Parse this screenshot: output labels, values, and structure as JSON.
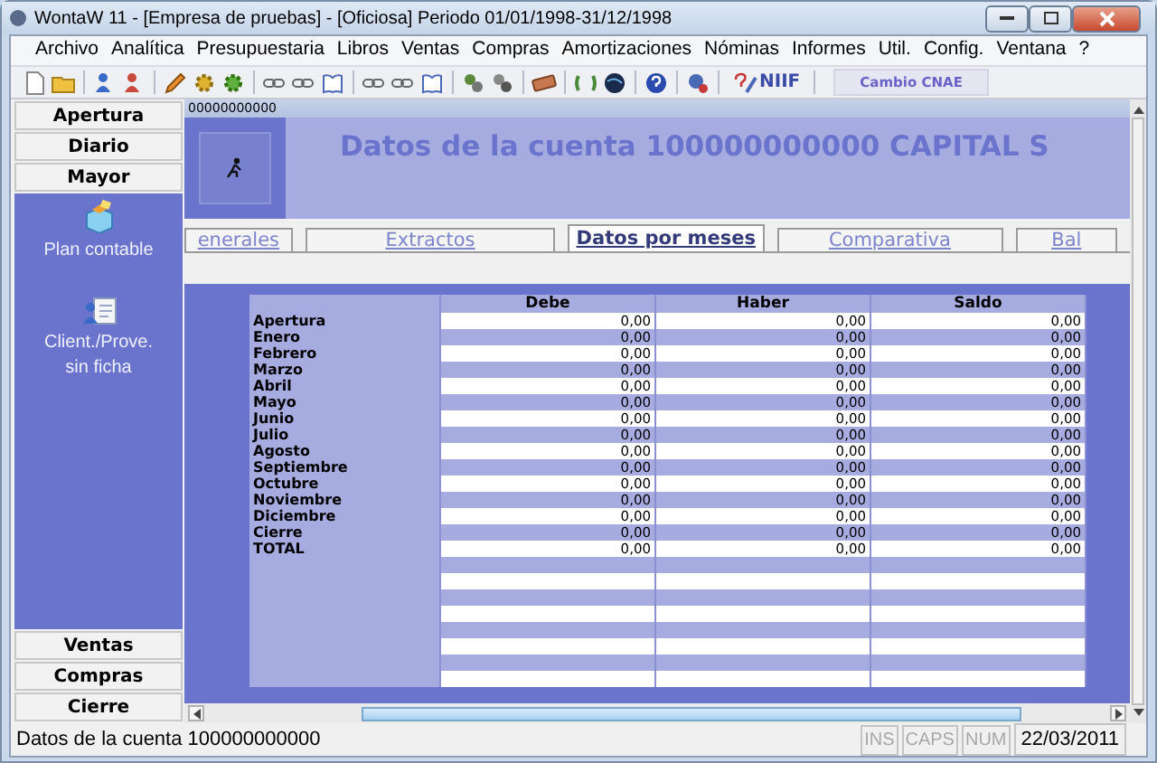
{
  "window": {
    "title": "WontaW 11 - [Empresa de pruebas] - [Oficiosa] Periodo 01/01/1998-31/12/1998"
  },
  "menu": [
    "Archivo",
    "Analítica",
    "Presupuestaria",
    "Libros",
    "Ventas",
    "Compras",
    "Amortizaciones",
    "Nóminas",
    "Informes",
    "Util.",
    "Config.",
    "Ventana",
    "?"
  ],
  "toolbar": {
    "niif_label": "NIIF",
    "cnae_button": "Cambio CNAE"
  },
  "sidebar": {
    "sections": [
      {
        "label": "Apertura"
      },
      {
        "label": "Diario"
      },
      {
        "label": "Mayor",
        "items": [
          {
            "kind": "plan",
            "label": "Plan contable"
          },
          {
            "kind": "contacts",
            "label": "Client./Prove. sin ficha"
          }
        ]
      },
      {
        "label": "Ventas"
      },
      {
        "label": "Compras"
      },
      {
        "label": "Cierre"
      }
    ]
  },
  "child_window": {
    "title": "00000000000",
    "heading": "Datos de la cuenta 100000000000 CAPITAL S",
    "tabs": [
      {
        "label": "enerales",
        "selected": false
      },
      {
        "label": "Extractos",
        "selected": false
      },
      {
        "label": "Datos por meses",
        "selected": true
      },
      {
        "label": "Comparativa",
        "selected": false
      },
      {
        "label": "Bal",
        "selected": false
      }
    ],
    "table": {
      "columns": [
        "Debe",
        "Haber",
        "Saldo"
      ],
      "rows": [
        {
          "label": "Apertura",
          "values": [
            "0,00",
            "0,00",
            "0,00"
          ]
        },
        {
          "label": "Enero",
          "values": [
            "0,00",
            "0,00",
            "0,00"
          ]
        },
        {
          "label": "Febrero",
          "values": [
            "0,00",
            "0,00",
            "0,00"
          ]
        },
        {
          "label": "Marzo",
          "values": [
            "0,00",
            "0,00",
            "0,00"
          ]
        },
        {
          "label": "Abril",
          "values": [
            "0,00",
            "0,00",
            "0,00"
          ]
        },
        {
          "label": "Mayo",
          "values": [
            "0,00",
            "0,00",
            "0,00"
          ]
        },
        {
          "label": "Junio",
          "values": [
            "0,00",
            "0,00",
            "0,00"
          ]
        },
        {
          "label": "Julio",
          "values": [
            "0,00",
            "0,00",
            "0,00"
          ]
        },
        {
          "label": "Agosto",
          "values": [
            "0,00",
            "0,00",
            "0,00"
          ]
        },
        {
          "label": "Septiembre",
          "values": [
            "0,00",
            "0,00",
            "0,00"
          ]
        },
        {
          "label": "Octubre",
          "values": [
            "0,00",
            "0,00",
            "0,00"
          ]
        },
        {
          "label": "Noviembre",
          "values": [
            "0,00",
            "0,00",
            "0,00"
          ]
        },
        {
          "label": "Diciembre",
          "values": [
            "0,00",
            "0,00",
            "0,00"
          ]
        },
        {
          "label": "Cierre",
          "values": [
            "0,00",
            "0,00",
            "0,00"
          ]
        },
        {
          "label": "TOTAL",
          "values": [
            "0,00",
            "0,00",
            "0,00"
          ]
        }
      ]
    }
  },
  "status_bar": {
    "message": "Datos de la cuenta 100000000000",
    "indicators": [
      {
        "label": "INS",
        "disabled": true
      },
      {
        "label": "CAPS",
        "disabled": true
      },
      {
        "label": "NUM",
        "disabled": true
      }
    ],
    "date": "22/03/2011"
  }
}
